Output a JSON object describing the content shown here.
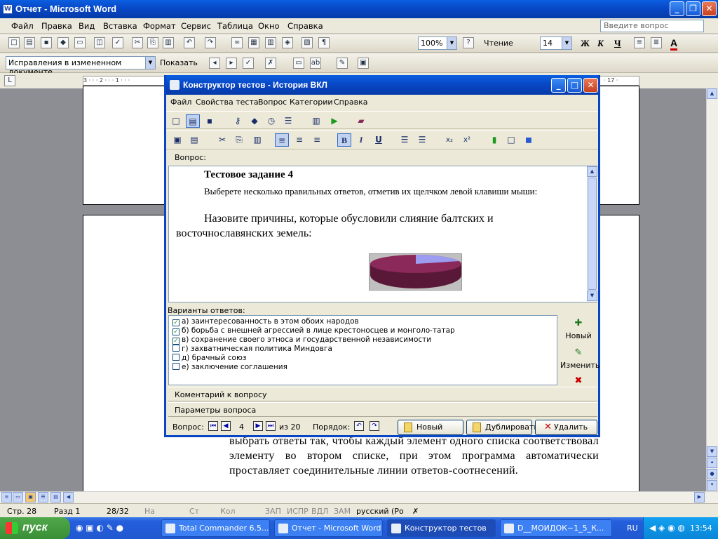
{
  "word": {
    "title": "Отчет - Microsoft Word",
    "menu": [
      "Файл",
      "Правка",
      "Вид",
      "Вставка",
      "Формат",
      "Сервис",
      "Таблица",
      "Окно",
      "Справка"
    ],
    "help_placeholder": "Введите вопрос",
    "zoom": "100%",
    "read_label": "Чтение",
    "font_size": "14",
    "bold": "Ж",
    "italic": "К",
    "underline": "Ч",
    "track_mode": "Исправления в измененном документе",
    "show_label": "Показать",
    "ruler_left": "3 · · · 2 · · · 1 · · ·",
    "ruler_right": "· 17 ·",
    "doc_paragraph": "выбрать ответы так, чтобы каждый элемент одного списка соответствовал элементу во втором списке, при этом программа автоматически проставляет соединительные линии ответов-соотнесений."
  },
  "status": {
    "page": "Стр. 28",
    "section": "Разд 1",
    "pages": "28/32",
    "at": "На",
    "line": "Ст",
    "col": "Кол",
    "rec": "ЗАП",
    "trk": "ИСПР",
    "ext": "ВДЛ",
    "ovr": "ЗАМ",
    "lang": "русский (Ро"
  },
  "taskbar": {
    "start": "пуск",
    "tasks": [
      "Total Commander 6.5...",
      "Отчет - Microsoft Word",
      "Конструктор тестов",
      "D__МОИДОК~1_5_К..."
    ],
    "lang": "RU",
    "clock": "13:54"
  },
  "dialog": {
    "title": "Конструктор тестов - История ВКЛ",
    "menu": [
      "Файл",
      "Свойства теста",
      "Вопрос",
      "Категории",
      "Справка"
    ],
    "question_label": "Вопрос:",
    "q_heading": "Тестовое задание 4",
    "q_instruction": "Выберете несколько правильных ответов, отметив их щелчком левой клавиши мыши:",
    "q_text": "Назовите причины, которые обусловили слияние балтских и восточнославянских земель:",
    "answers_label": "Варианты ответов:",
    "answers": [
      {
        "text": "а)  заинтересованность в этом обоих народов",
        "checked": true
      },
      {
        "text": "б) борьба с внешней агрессией в лице крестоносцев и монголо-татар",
        "checked": true
      },
      {
        "text": "в) сохранение своего этноса и государственной независимости",
        "checked": true
      },
      {
        "text": "г) захватническая политика Миндовга",
        "checked": false
      },
      {
        "text": "д) брачный союз",
        "checked": false
      },
      {
        "text": "е) заключение соглашения",
        "checked": false
      }
    ],
    "new_label": "Новый",
    "edit_label": "Изменить",
    "comment_label": "Коментарий к вопросу",
    "params_label": "Параметры вопроса",
    "nav_label": "Вопрос:",
    "current": "4",
    "of_total": "из 20",
    "order_label": "Порядок:",
    "btn_new": "Новый",
    "btn_dup": "Дублировать",
    "btn_del": "Удалить"
  },
  "colors": {
    "pie_main": "#8b2a5a",
    "pie_slice": "#9c9cf0",
    "pie_side": "#5a1838"
  }
}
